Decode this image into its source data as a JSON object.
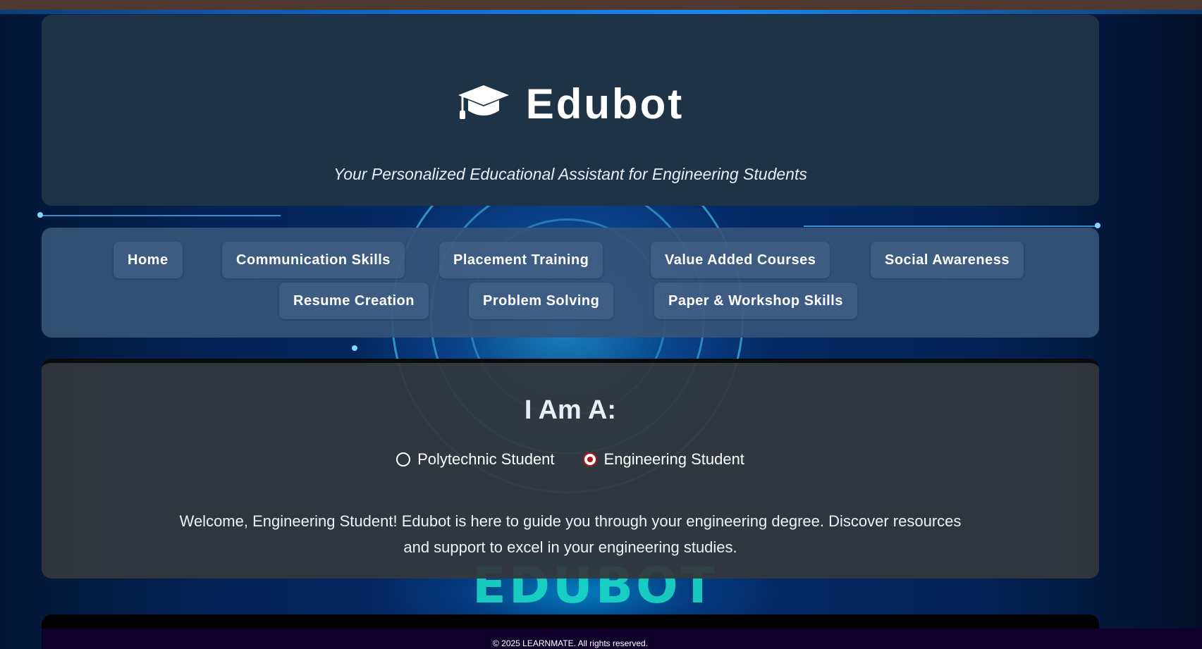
{
  "header": {
    "icon": "graduation-cap-icon",
    "title": "Edubot",
    "tagline": "Your Personalized Educational Assistant for Engineering Students"
  },
  "nav": {
    "items": [
      {
        "label": "Home"
      },
      {
        "label": "Communication Skills"
      },
      {
        "label": "Placement Training"
      },
      {
        "label": "Value Added Courses"
      },
      {
        "label": "Social Awareness"
      },
      {
        "label": "Resume Creation"
      },
      {
        "label": "Problem Solving"
      },
      {
        "label": "Paper & Workshop Skills"
      }
    ]
  },
  "role_selector": {
    "heading": "I Am A:",
    "options": [
      {
        "label": "Polytechnic Student",
        "selected": false
      },
      {
        "label": "Engineering Student",
        "selected": true
      }
    ],
    "welcome_message": "Welcome, Engineering Student! Edubot is here to guide you through your engineering degree. Discover resources and support to excel in your engineering studies."
  },
  "background": {
    "watermark": "EDUBOT"
  },
  "footer": {
    "copyright": "© 2025 LEARNMATE. All rights reserved."
  },
  "colors": {
    "header_bg": "#1f3347",
    "nav_bg": "#365478",
    "content_bg": "#34383c",
    "radio_selected": "#b01818",
    "footer_bg": "#11002b"
  }
}
